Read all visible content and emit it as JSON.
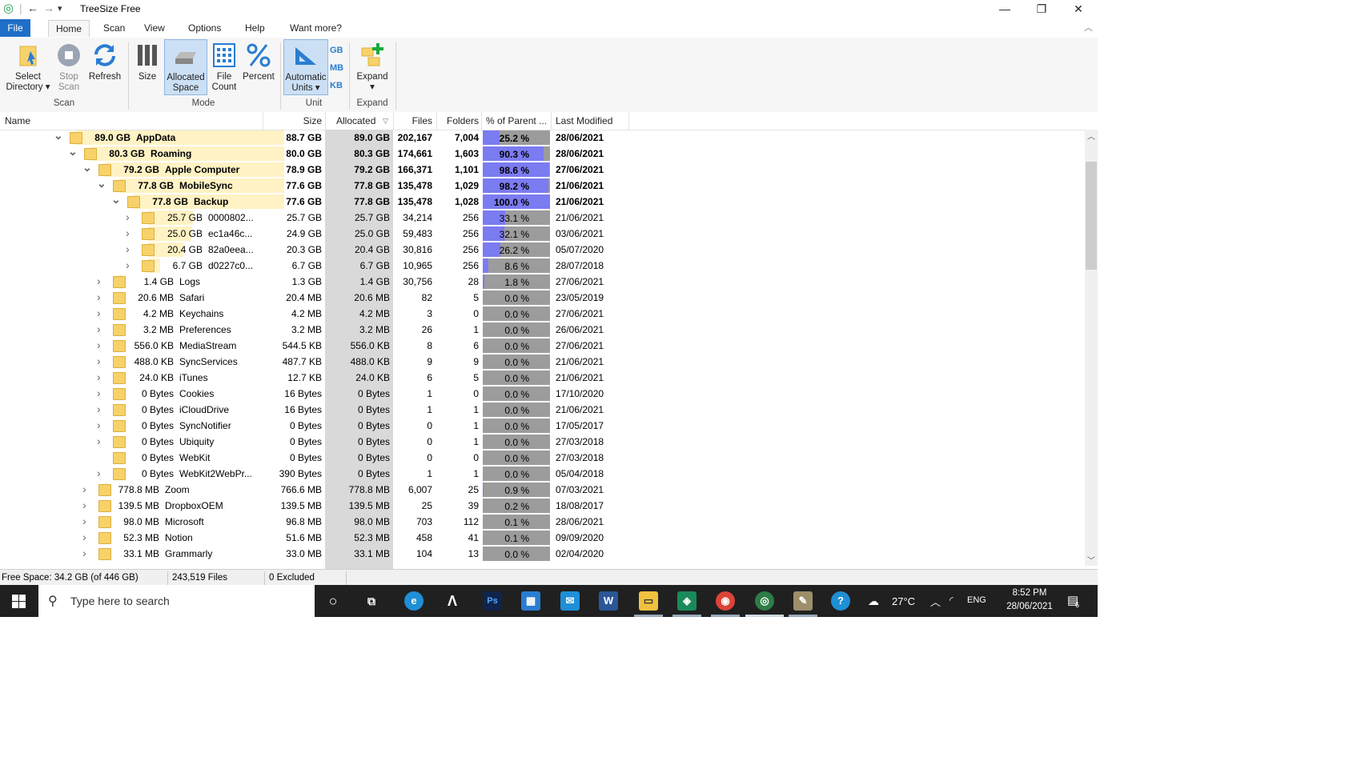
{
  "window": {
    "title": "TreeSize Free",
    "controls": {
      "minimize": "—",
      "restore": "❐",
      "close": "✕"
    }
  },
  "menu_tabs": [
    "File",
    "Home",
    "Scan",
    "View",
    "Options",
    "Help",
    "Want more?"
  ],
  "ribbon": {
    "scan": {
      "group": "Scan",
      "select_directory": [
        "Select",
        "Directory ▾"
      ],
      "stop_scan": [
        "Stop",
        "Scan"
      ],
      "refresh": "Refresh"
    },
    "mode": {
      "group": "Mode",
      "size": "Size",
      "allocated_space": [
        "Allocated",
        "Space"
      ],
      "file_count": [
        "File",
        "Count"
      ],
      "percent": "Percent"
    },
    "unit": {
      "group": "Unit",
      "automatic_units": [
        "Automatic",
        "Units ▾"
      ],
      "gb": "GB",
      "mb": "MB",
      "kb": "KB"
    },
    "expand": {
      "group": "Expand",
      "expand": [
        "Expand",
        "▾"
      ]
    }
  },
  "columns": [
    "Name",
    "Size",
    "Allocated",
    "Files",
    "Folders",
    "% of Parent ...",
    "Last Modified"
  ],
  "rows": [
    {
      "depth": 0,
      "exp": "v",
      "label": "89.0 GB",
      "name": "AppData",
      "size": "88.7 GB",
      "alloc": "89.0 GB",
      "files": "202,167",
      "folders": "7,004",
      "pct": "25.2 %",
      "pv": 25.2,
      "mod": "28/06/2021",
      "bold": true,
      "bar": 1.0
    },
    {
      "depth": 1,
      "exp": "v",
      "label": "80.3 GB",
      "name": "Roaming",
      "size": "80.0 GB",
      "alloc": "80.3 GB",
      "files": "174,661",
      "folders": "1,603",
      "pct": "90.3 %",
      "pv": 90.3,
      "mod": "28/06/2021",
      "bold": true,
      "bar": 1.0
    },
    {
      "depth": 2,
      "exp": "v",
      "label": "79.2 GB",
      "name": "Apple Computer",
      "size": "78.9 GB",
      "alloc": "79.2 GB",
      "files": "166,371",
      "folders": "1,101",
      "pct": "98.6 %",
      "pv": 98.6,
      "mod": "27/06/2021",
      "bold": true,
      "bar": 1.0
    },
    {
      "depth": 3,
      "exp": "v",
      "label": "77.8 GB",
      "name": "MobileSync",
      "size": "77.6 GB",
      "alloc": "77.8 GB",
      "files": "135,478",
      "folders": "1,029",
      "pct": "98.2 %",
      "pv": 98.2,
      "mod": "21/06/2021",
      "bold": true,
      "bar": 1.0
    },
    {
      "depth": 4,
      "exp": "v",
      "label": "77.8 GB",
      "name": "Backup",
      "size": "77.6 GB",
      "alloc": "77.8 GB",
      "files": "135,478",
      "folders": "1,028",
      "pct": "100.0 %",
      "pv": 100,
      "mod": "21/06/2021",
      "bold": true,
      "bar": 1.0
    },
    {
      "depth": 5,
      "exp": ">",
      "label": "25.7 GB",
      "name": "0000802...",
      "size": "25.7 GB",
      "alloc": "25.7 GB",
      "files": "34,214",
      "folders": "256",
      "pct": "33.1 %",
      "pv": 33.1,
      "mod": "21/06/2021",
      "bold": false,
      "bar": 0.33
    },
    {
      "depth": 5,
      "exp": ">",
      "label": "25.0 GB",
      "name": "ec1a46c...",
      "size": "24.9 GB",
      "alloc": "25.0 GB",
      "files": "59,483",
      "folders": "256",
      "pct": "32.1 %",
      "pv": 32.1,
      "mod": "03/06/2021",
      "bold": false,
      "bar": 0.32
    },
    {
      "depth": 5,
      "exp": ">",
      "label": "20.4 GB",
      "name": "82a0eea...",
      "size": "20.3 GB",
      "alloc": "20.4 GB",
      "files": "30,816",
      "folders": "256",
      "pct": "26.2 %",
      "pv": 26.2,
      "mod": "05/07/2020",
      "bold": false,
      "bar": 0.26
    },
    {
      "depth": 5,
      "exp": ">",
      "label": "6.7 GB",
      "name": "d0227c0...",
      "size": "6.7 GB",
      "alloc": "6.7 GB",
      "files": "10,965",
      "folders": "256",
      "pct": "8.6 %",
      "pv": 8.6,
      "mod": "28/07/2018",
      "bold": false,
      "bar": 0.09
    },
    {
      "depth": 3,
      "exp": ">",
      "label": "1.4 GB",
      "name": "Logs",
      "size": "1.3 GB",
      "alloc": "1.4 GB",
      "files": "30,756",
      "folders": "28",
      "pct": "1.8 %",
      "pv": 1.8,
      "mod": "27/06/2021",
      "bold": false,
      "bar": 0.02
    },
    {
      "depth": 3,
      "exp": ">",
      "label": "20.6 MB",
      "name": "Safari",
      "size": "20.4 MB",
      "alloc": "20.6 MB",
      "files": "82",
      "folders": "5",
      "pct": "0.0 %",
      "pv": 0,
      "mod": "23/05/2019",
      "bold": false,
      "bar": 0
    },
    {
      "depth": 3,
      "exp": ">",
      "label": "4.2 MB",
      "name": "Keychains",
      "size": "4.2 MB",
      "alloc": "4.2 MB",
      "files": "3",
      "folders": "0",
      "pct": "0.0 %",
      "pv": 0,
      "mod": "27/06/2021",
      "bold": false,
      "bar": 0
    },
    {
      "depth": 3,
      "exp": ">",
      "label": "3.2 MB",
      "name": "Preferences",
      "size": "3.2 MB",
      "alloc": "3.2 MB",
      "files": "26",
      "folders": "1",
      "pct": "0.0 %",
      "pv": 0,
      "mod": "26/06/2021",
      "bold": false,
      "bar": 0
    },
    {
      "depth": 3,
      "exp": ">",
      "label": "556.0 KB",
      "name": "MediaStream",
      "size": "544.5 KB",
      "alloc": "556.0 KB",
      "files": "8",
      "folders": "6",
      "pct": "0.0 %",
      "pv": 0,
      "mod": "27/06/2021",
      "bold": false,
      "bar": 0
    },
    {
      "depth": 3,
      "exp": ">",
      "label": "488.0 KB",
      "name": "SyncServices",
      "size": "487.7 KB",
      "alloc": "488.0 KB",
      "files": "9",
      "folders": "9",
      "pct": "0.0 %",
      "pv": 0,
      "mod": "21/06/2021",
      "bold": false,
      "bar": 0
    },
    {
      "depth": 3,
      "exp": ">",
      "label": "24.0 KB",
      "name": "iTunes",
      "size": "12.7 KB",
      "alloc": "24.0 KB",
      "files": "6",
      "folders": "5",
      "pct": "0.0 %",
      "pv": 0,
      "mod": "21/06/2021",
      "bold": false,
      "bar": 0
    },
    {
      "depth": 3,
      "exp": ">",
      "label": "0 Bytes",
      "name": "Cookies",
      "size": "16 Bytes",
      "alloc": "0 Bytes",
      "files": "1",
      "folders": "0",
      "pct": "0.0 %",
      "pv": 0,
      "mod": "17/10/2020",
      "bold": false,
      "bar": 0
    },
    {
      "depth": 3,
      "exp": ">",
      "label": "0 Bytes",
      "name": "iCloudDrive",
      "size": "16 Bytes",
      "alloc": "0 Bytes",
      "files": "1",
      "folders": "1",
      "pct": "0.0 %",
      "pv": 0,
      "mod": "21/06/2021",
      "bold": false,
      "bar": 0
    },
    {
      "depth": 3,
      "exp": ">",
      "label": "0 Bytes",
      "name": "SyncNotifier",
      "size": "0 Bytes",
      "alloc": "0 Bytes",
      "files": "0",
      "folders": "1",
      "pct": "0.0 %",
      "pv": 0,
      "mod": "17/05/2017",
      "bold": false,
      "bar": 0
    },
    {
      "depth": 3,
      "exp": ">",
      "label": "0 Bytes",
      "name": "Ubiquity",
      "size": "0 Bytes",
      "alloc": "0 Bytes",
      "files": "0",
      "folders": "1",
      "pct": "0.0 %",
      "pv": 0,
      "mod": "27/03/2018",
      "bold": false,
      "bar": 0
    },
    {
      "depth": 3,
      "exp": "",
      "label": "0 Bytes",
      "name": "WebKit",
      "size": "0 Bytes",
      "alloc": "0 Bytes",
      "files": "0",
      "folders": "0",
      "pct": "0.0 %",
      "pv": 0,
      "mod": "27/03/2018",
      "bold": false,
      "bar": 0
    },
    {
      "depth": 3,
      "exp": ">",
      "label": "0 Bytes",
      "name": "WebKit2WebPr...",
      "size": "390 Bytes",
      "alloc": "0 Bytes",
      "files": "1",
      "folders": "1",
      "pct": "0.0 %",
      "pv": 0,
      "mod": "05/04/2018",
      "bold": false,
      "bar": 0
    },
    {
      "depth": 2,
      "exp": ">",
      "label": "778.8 MB",
      "name": "Zoom",
      "size": "766.6 MB",
      "alloc": "778.8 MB",
      "files": "6,007",
      "folders": "25",
      "pct": "0.9 %",
      "pv": 0.9,
      "mod": "07/03/2021",
      "bold": false,
      "bar": 0.01
    },
    {
      "depth": 2,
      "exp": ">",
      "label": "139.5 MB",
      "name": "DropboxOEM",
      "size": "139.5 MB",
      "alloc": "139.5 MB",
      "files": "25",
      "folders": "39",
      "pct": "0.2 %",
      "pv": 0.2,
      "mod": "18/08/2017",
      "bold": false,
      "bar": 0
    },
    {
      "depth": 2,
      "exp": ">",
      "label": "98.0 MB",
      "name": "Microsoft",
      "size": "96.8 MB",
      "alloc": "98.0 MB",
      "files": "703",
      "folders": "112",
      "pct": "0.1 %",
      "pv": 0.1,
      "mod": "28/06/2021",
      "bold": false,
      "bar": 0
    },
    {
      "depth": 2,
      "exp": ">",
      "label": "52.3 MB",
      "name": "Notion",
      "size": "51.6 MB",
      "alloc": "52.3 MB",
      "files": "458",
      "folders": "41",
      "pct": "0.1 %",
      "pv": 0.1,
      "mod": "09/09/2020",
      "bold": false,
      "bar": 0
    },
    {
      "depth": 2,
      "exp": ">",
      "label": "33.1 MB",
      "name": "Grammarly",
      "size": "33.0 MB",
      "alloc": "33.1 MB",
      "files": "104",
      "folders": "13",
      "pct": "0.0 %",
      "pv": 0,
      "mod": "02/04/2020",
      "bold": false,
      "bar": 0
    }
  ],
  "status": {
    "free_space": "Free Space: 34.2 GB  (of 446 GB)",
    "files": "243,519 Files",
    "excluded": "0 Excluded"
  },
  "taskbar": {
    "search_placeholder": "Type here to search",
    "weather": "27°C",
    "lang": "ENG",
    "time": "8:52 PM",
    "date": "28/06/2021",
    "notifications": "6",
    "apps": [
      "cortana",
      "task-view",
      "edge",
      "app-a",
      "photoshop",
      "store",
      "mail",
      "word",
      "explorer",
      "app-green",
      "chrome",
      "treesize",
      "paint"
    ]
  },
  "colors": {
    "accent": "#1e6fc8",
    "alloc_column": "#d9d9d9",
    "pct_fill": "#7b7bf2",
    "size_bar": "#fff2c4",
    "folder": "#f7d26a"
  }
}
